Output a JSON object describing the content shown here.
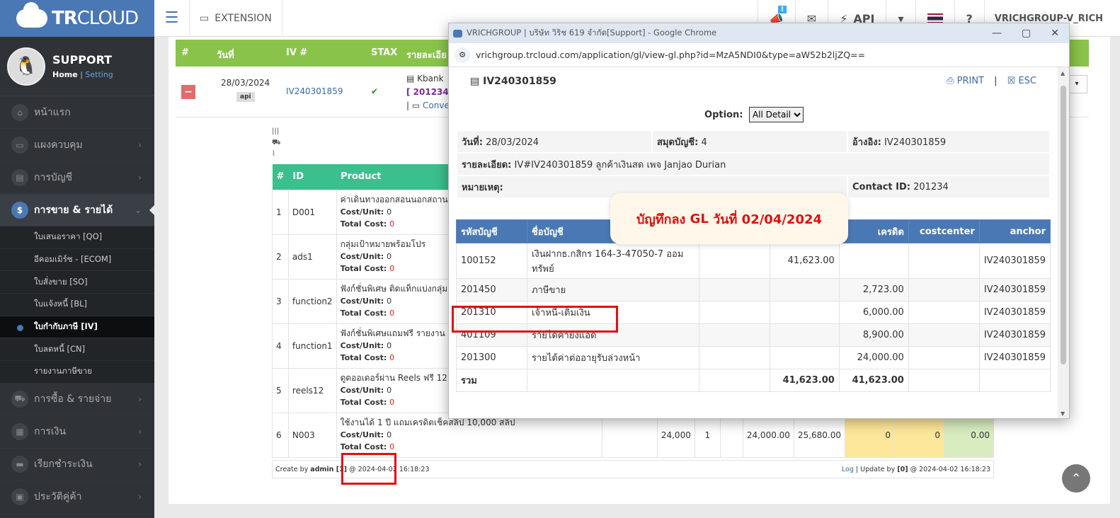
{
  "brand": {
    "name_bold": "TR",
    "name_light": "CLOUD"
  },
  "profile": {
    "name": "SUPPORT",
    "home": "Home",
    "sep": "|",
    "setting": "Setting"
  },
  "menu": [
    {
      "label": "หน้าแรก",
      "icon": "home-icon",
      "glyph": "⌂"
    },
    {
      "label": "แผงควบคุม",
      "icon": "monitor-icon",
      "glyph": "▭"
    },
    {
      "label": "การบัญชี",
      "icon": "book-icon",
      "glyph": "▤"
    },
    {
      "label": "การขาย & รายได้",
      "icon": "dollar-icon",
      "glyph": "$"
    }
  ],
  "submenu": [
    "ใบเสนอราคา [QO]",
    "อีคอมเมิร์ซ - [ECOM]",
    "ใบสั่งขาย [SO]",
    "ใบแจ้งหนี้ [BL]",
    "ใบกำกับภาษี [IV]",
    "ใบลดหนี้ [CN]",
    "รายงานภาษีขาย"
  ],
  "menu2": [
    {
      "label": "การซื้อ & รายจ่าย",
      "icon": "cart-icon",
      "glyph": "⛟"
    },
    {
      "label": "การเงิน",
      "icon": "calendar-icon",
      "glyph": "▦"
    },
    {
      "label": "เรียกชำระเงิน",
      "icon": "card-icon",
      "glyph": "▬"
    },
    {
      "label": "ประวัติคู่ค้า",
      "icon": "contact-icon",
      "glyph": "▣"
    }
  ],
  "topbar": {
    "extension": "EXTENSION",
    "api": "API",
    "user": "VRICHGROUP-V_RICH",
    "badge": "!"
  },
  "list_header": {
    "col_hash": "#",
    "col_date": "วันที่",
    "col_iv": "IV #",
    "col_stax": "STAX",
    "col_detail": "รายละเอีย"
  },
  "row": {
    "date": "28/03/2024",
    "api": "api",
    "iv": "IV240301859",
    "check": "✔",
    "bank": "Kbank",
    "contact": "[ 201234, j",
    "convert": "Conve",
    "minus": "−"
  },
  "product_table": {
    "headers": [
      "#",
      "ID",
      "Product"
    ],
    "rows": [
      {
        "n": "1",
        "id": "D001",
        "name": "ค่าเดินทางออกสอนนอกสถานที่",
        "unit": "0",
        "total": "0"
      },
      {
        "n": "2",
        "id": "ads1",
        "name": "กลุ่มเป้าหมายพร้อมโปร",
        "unit": "0",
        "total": "0"
      },
      {
        "n": "3",
        "id": "function2",
        "name": "ฟังก์ชั่นพิเศษ ติดแท็กแบ่งกลุ่ม",
        "unit": "0",
        "total": "0"
      },
      {
        "n": "4",
        "id": "function1",
        "name": "ฟังก์ชั่นพิเศษแถมฟรี รายงาน",
        "unit": "0",
        "total": "0"
      },
      {
        "n": "5",
        "id": "reels12",
        "name": "ดูดออเดอร์ผ่าน Reels ฟรี 12",
        "unit": "0",
        "total": "0"
      },
      {
        "n": "6",
        "id": "N003",
        "name": "ใช้งานได้ 1 ปี แถมเครดิตเช็คสลิป 10,000 สลิป",
        "unit": "0",
        "total": "0",
        "qty": "24,000",
        "cnt": "1",
        "amount": "24,000.00",
        "amount_vat": "25,680.00",
        "y1": "0",
        "y2": "0",
        "g": "0.00"
      }
    ],
    "cost_unit_label": "Cost/Unit:",
    "total_cost_label": "Total Cost:"
  },
  "footer": {
    "create_prefix": "Create by",
    "create_user": "admin [1]",
    "at": "@",
    "create_date": "2024-04-02",
    "create_time": "16:18:23",
    "log": "Log",
    "update_text": "| Update by",
    "update_user": "[0]",
    "update_at": "@ 2024-04-02 16:18:23"
  },
  "popup": {
    "window_title": "VRICHGROUP | บริษัท วิริช 619 จำกัด[Support] - Google Chrome",
    "url": "vrichgroup.trcloud.com/application/gl/view-gl.php?id=MzA5NDI0&type=aW52b2ljZQ==",
    "doc_id": "IV240301859",
    "print": "PRINT",
    "esc": "ESC",
    "sep": "|",
    "option_label": "Option:",
    "option_value": "All Detail",
    "date_label": "วันที่:",
    "date_value": "28/03/2024",
    "journal_label": "สมุดบัญชี:",
    "journal_value": "4",
    "ref_label": "อ้างอิง:",
    "ref_value": "IV240301859",
    "detail_label": "รายละเอียด:",
    "detail_value": "IV#IV240301859 ลูกค้าเงินสด เพจ Janjao Durian",
    "note_label": "หมายเหตุ:",
    "contact_label": "Contact ID:",
    "contact_value": "201234",
    "callout_prefix": "บัญทึกลง",
    "callout_gl": "GL",
    "callout_suffix": "วันที่ 02/04/2024",
    "gl_headers": [
      "รหัสบัญชี",
      "ชื่อบัญชี",
      "",
      "",
      "เครดิต",
      "costcenter",
      "anchor"
    ],
    "gl_rows": [
      {
        "code": "100152",
        "name": "เงินฝากธ.กสิกร 164-3-47050-7 ออมทรัพย์",
        "debit": "41,623.00",
        "credit": "",
        "anchor": "IV240301859"
      },
      {
        "code": "201450",
        "name": "ภาษีขาย",
        "debit": "",
        "credit": "2,723.00",
        "anchor": "IV240301859"
      },
      {
        "code": "201310",
        "name": "เจ้าหนี้-เติมเงิน",
        "debit": "",
        "credit": "6,000.00",
        "anchor": "IV240301859"
      },
      {
        "code": "401109",
        "name": "รายได้ค่ายิงแอด",
        "debit": "",
        "credit": "8,900.00",
        "anchor": "IV240301859"
      },
      {
        "code": "201300",
        "name": "รายได้ค่าต่ออายุรับล่วงหน้า",
        "debit": "",
        "credit": "24,000.00",
        "anchor": "IV240301859"
      }
    ],
    "total_label": "รวม",
    "total_debit": "41,623.00",
    "total_credit": "41,623.00"
  },
  "colors": {
    "accent": "#4a78b5",
    "green": "#8ac34a",
    "teal": "#3bbf8c",
    "highlight": "#e01010"
  }
}
